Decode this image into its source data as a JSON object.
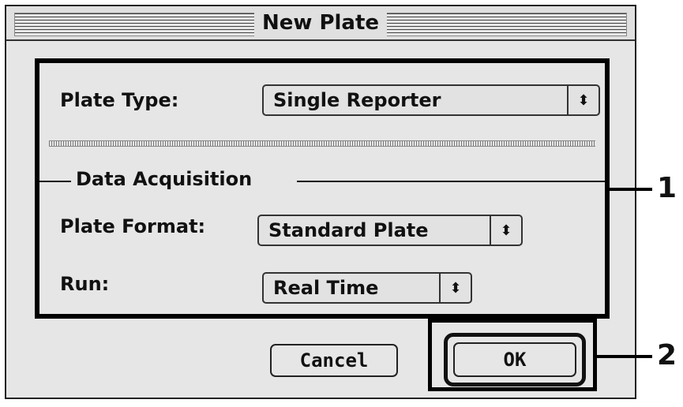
{
  "window": {
    "title": "New Plate"
  },
  "plate_type": {
    "label": "Plate Type:",
    "value": "Single Reporter"
  },
  "data_acquisition": {
    "group_title": "Data Acquisition",
    "plate_format": {
      "label": "Plate Format:",
      "value": "Standard Plate"
    },
    "run": {
      "label": "Run:",
      "value": "Real Time"
    }
  },
  "buttons": {
    "cancel": "Cancel",
    "ok": "OK"
  },
  "callouts": [
    "1",
    "2"
  ],
  "icons": {
    "popup_arrow": "up-down-arrows-icon"
  }
}
